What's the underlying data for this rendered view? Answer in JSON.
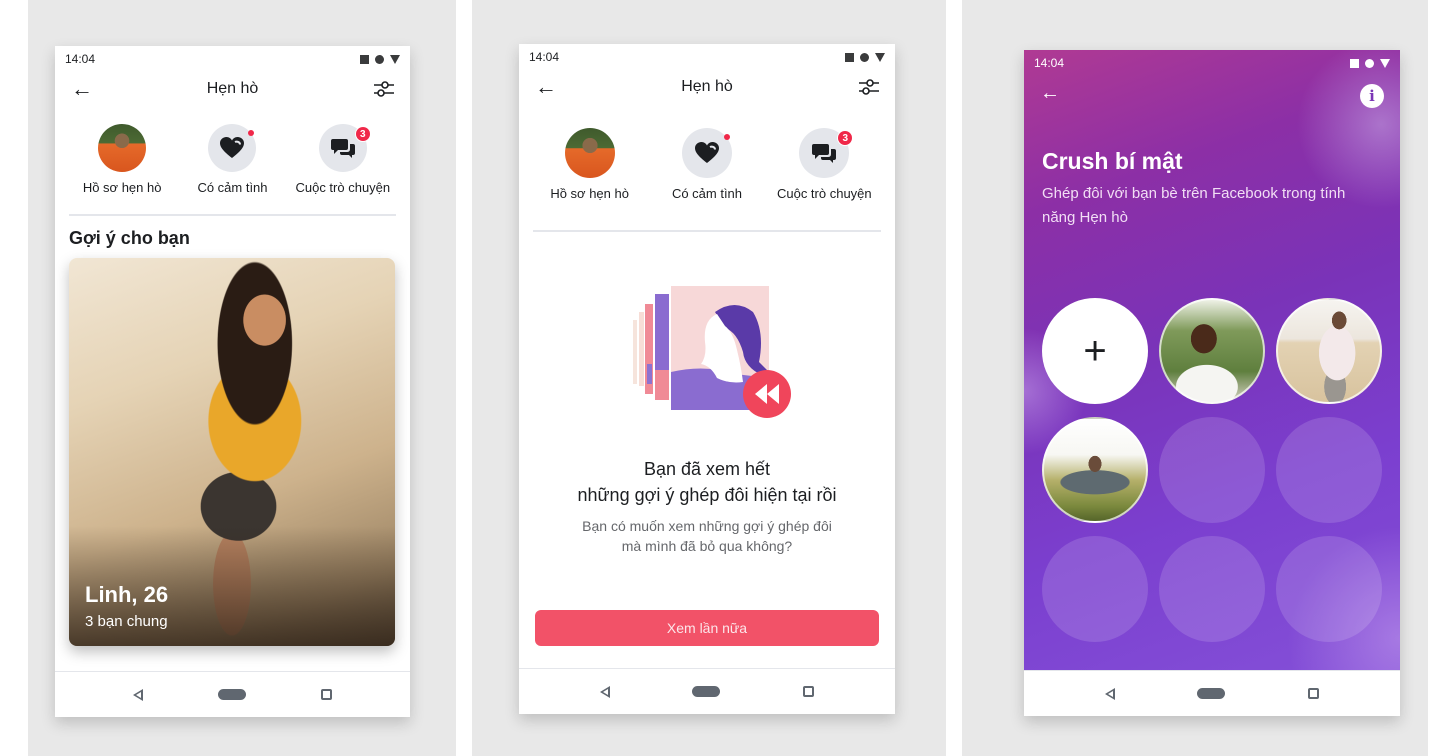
{
  "screens": [
    {
      "status_time": "14:04",
      "title": "Hẹn hò",
      "shortcuts": [
        {
          "label": "Hồ sơ hẹn hò",
          "icon": "profile-avatar"
        },
        {
          "label": "Có cảm tình",
          "icon": "heart-icon",
          "indicator": "dot"
        },
        {
          "label": "Cuộc trò chuyện",
          "icon": "chat-bubbles-icon",
          "badge": "3"
        }
      ],
      "section_title": "Gợi ý cho bạn",
      "card": {
        "name": "Linh, 26",
        "mutual": "3 bạn chung"
      }
    },
    {
      "status_time": "14:04",
      "title": "Hẹn hò",
      "shortcuts": [
        {
          "label": "Hồ sơ hẹn hò",
          "icon": "profile-avatar"
        },
        {
          "label": "Có cảm tình",
          "icon": "heart-icon",
          "indicator": "dot"
        },
        {
          "label": "Cuộc trò chuyện",
          "icon": "chat-bubbles-icon",
          "badge": "3"
        }
      ],
      "empty_title_line1": "Bạn đã xem hết",
      "empty_title_line2": "những gợi ý ghép đôi hiện tại rồi",
      "empty_sub_line1": "Bạn có muốn xem những gợi ý ghép đôi",
      "empty_sub_line2": "mà mình đã bỏ qua không?",
      "button_label": "Xem lần nữa"
    },
    {
      "status_time": "14:04",
      "title": "Crush bí mật",
      "subtitle": "Ghép đôi với bạn bè trên Facebook trong tính năng Hẹn hò",
      "add_symbol": "+",
      "info_symbol": "i",
      "slots": [
        "add",
        "friend",
        "friend",
        "friend",
        "empty",
        "empty",
        "empty",
        "empty",
        "empty"
      ]
    }
  ],
  "colors": {
    "accent_red": "#f25268",
    "badge_red": "#f02849",
    "purple": "#7b3fcf",
    "text_primary": "#1c1e21",
    "text_secondary": "#65676b"
  },
  "icons": {
    "back": "←",
    "filter": "sliders-icon",
    "nav": [
      "back-triangle",
      "home-pill",
      "recents-square"
    ]
  }
}
